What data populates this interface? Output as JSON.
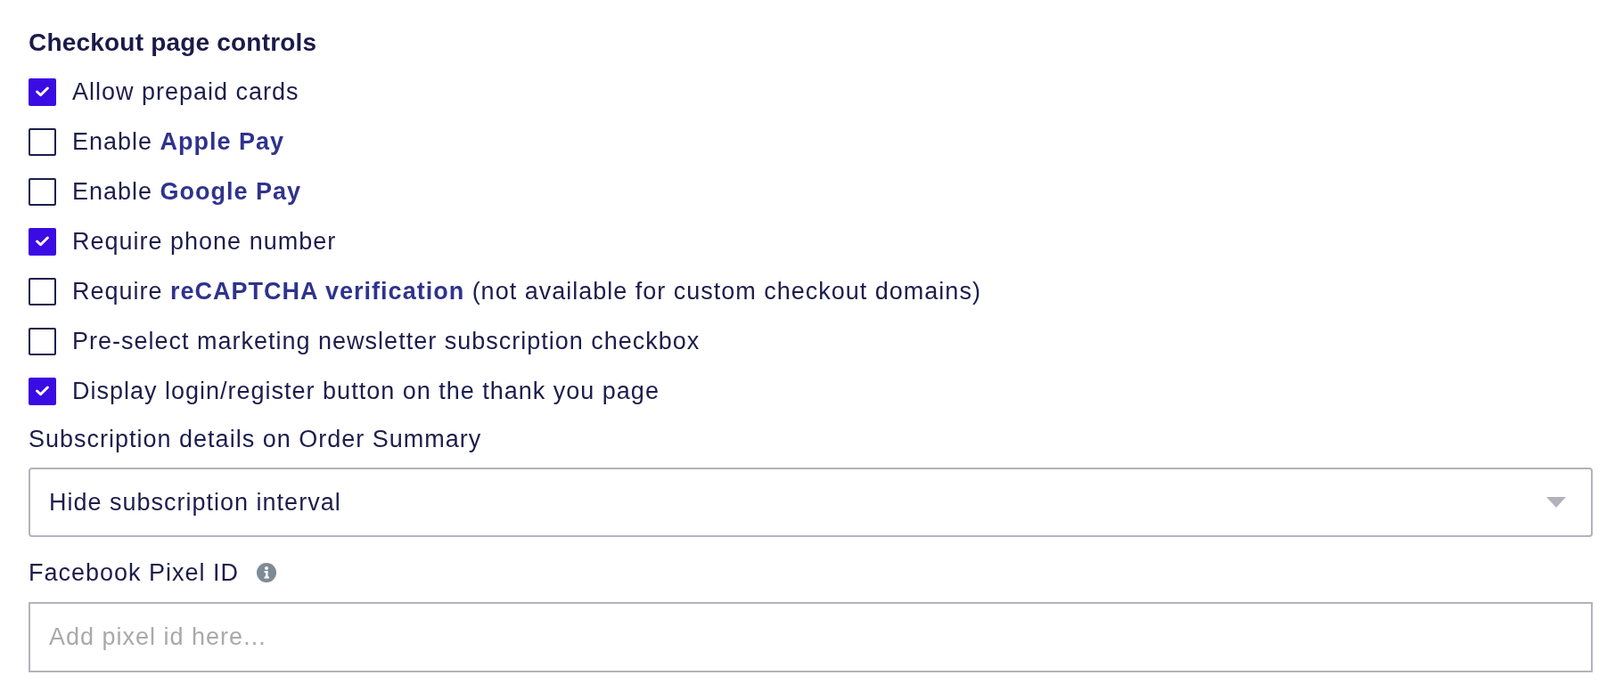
{
  "section": {
    "title": "Checkout page controls"
  },
  "options": [
    {
      "checked": true,
      "label": [
        {
          "kind": "text",
          "text": "Allow prepaid cards"
        }
      ]
    },
    {
      "checked": false,
      "label": [
        {
          "kind": "text",
          "text": "Enable "
        },
        {
          "kind": "link",
          "text": "Apple Pay"
        }
      ]
    },
    {
      "checked": false,
      "label": [
        {
          "kind": "text",
          "text": "Enable "
        },
        {
          "kind": "link",
          "text": "Google Pay"
        }
      ]
    },
    {
      "checked": true,
      "label": [
        {
          "kind": "text",
          "text": "Require phone number"
        }
      ]
    },
    {
      "checked": false,
      "label": [
        {
          "kind": "text",
          "text": "Require "
        },
        {
          "kind": "link",
          "text": "reCAPTCHA verification"
        },
        {
          "kind": "text",
          "text": " (not available for custom checkout domains)"
        }
      ]
    },
    {
      "checked": false,
      "label": [
        {
          "kind": "text",
          "text": "Pre-select marketing newsletter subscription checkbox"
        }
      ]
    },
    {
      "checked": true,
      "label": [
        {
          "kind": "text",
          "text": "Display login/register button on the thank you page"
        }
      ]
    }
  ],
  "subscription_details": {
    "label": "Subscription details on Order Summary",
    "value": "Hide subscription interval"
  },
  "pixel_id": {
    "label": "Facebook Pixel ID",
    "placeholder": "Add pixel id here..."
  }
}
